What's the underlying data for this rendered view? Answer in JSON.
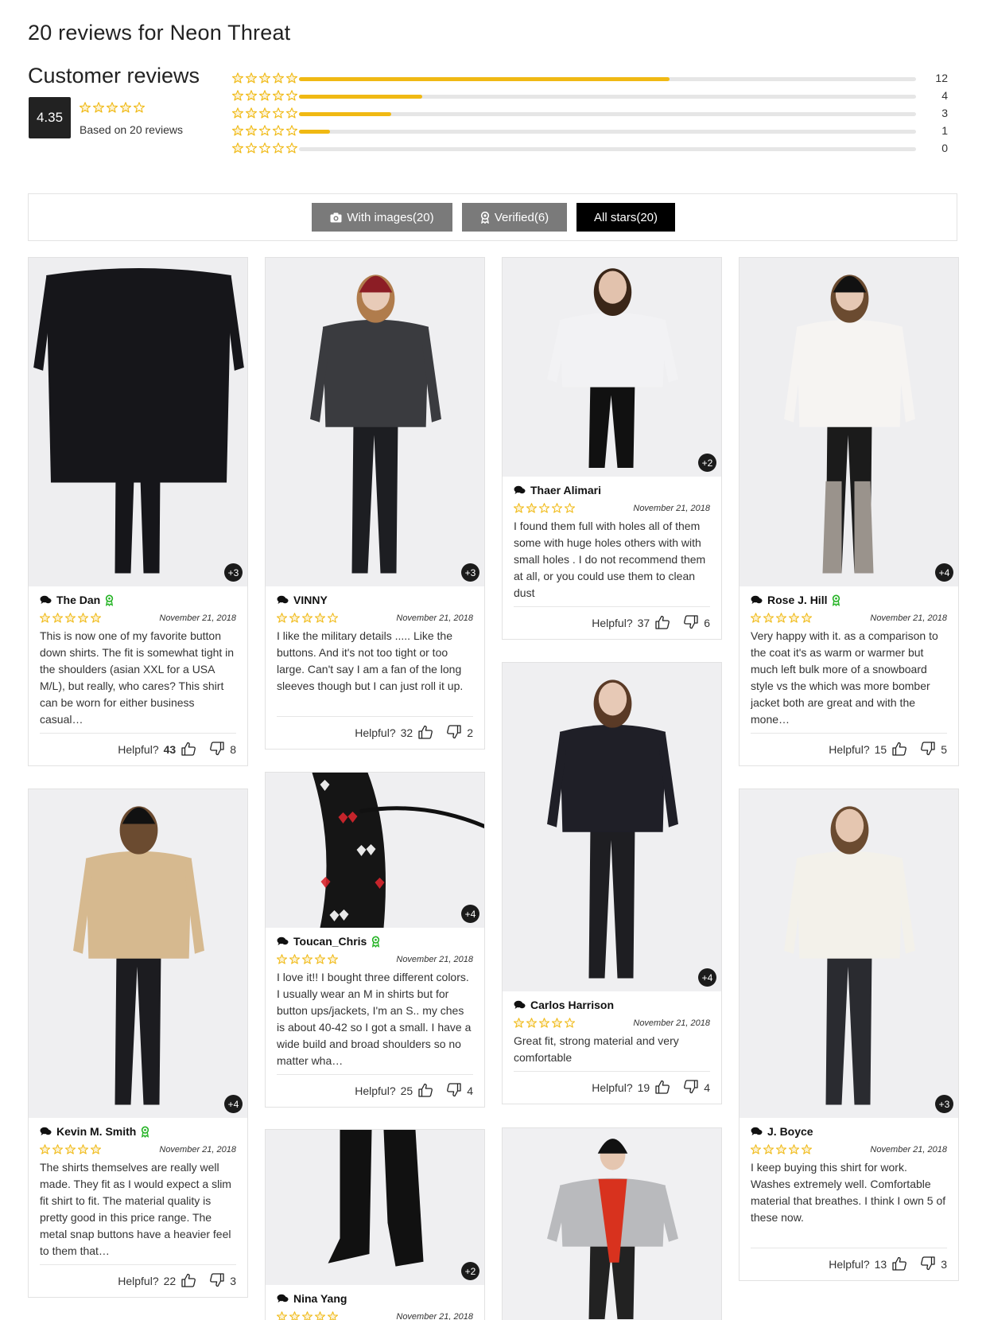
{
  "page_title": "20 reviews for Neon Threat",
  "summary": {
    "title": "Customer reviews",
    "average": "4.35",
    "based_on": "Based on 20 reviews",
    "distribution": [
      {
        "stars": 5,
        "count": "12",
        "fraction": 0.6
      },
      {
        "stars": 4,
        "count": "4",
        "fraction": 0.2
      },
      {
        "stars": 3,
        "count": "3",
        "fraction": 0.15
      },
      {
        "stars": 2,
        "count": "1",
        "fraction": 0.05
      },
      {
        "stars": 1,
        "count": "0",
        "fraction": 0
      }
    ]
  },
  "filters": {
    "with_images": "With images(20)",
    "verified": "Verified(6)",
    "all_stars": "All stars(20)"
  },
  "helpful_label": "Helpful?",
  "colors": {
    "star": "#f0b913",
    "verified": "#27b427",
    "accent_dark": "#000000"
  },
  "reviews": [
    {
      "author": "The Dan",
      "verified": true,
      "rating": 5,
      "date": "November 21, 2018",
      "more_images": "+3",
      "text": "This is now one of my favorite button down shirts. The fit is somewhat tight in the shoulders (asian XXL for a USA M/L), but really, who cares? This shirt can be worn for either business casual…",
      "helpful_yes": "43",
      "helpful_no": "8",
      "yes_bold": true
    },
    {
      "author": "VINNY",
      "verified": false,
      "rating": 4,
      "date": "November 21, 2018",
      "more_images": "+3",
      "text": "I like the military details ..... Like the buttons. And it's not too tight or too large. Can't say I am a fan of the long sleeves though but I can just roll it up.",
      "helpful_yes": "32",
      "helpful_no": "2"
    },
    {
      "author": "Thaer Alimari",
      "verified": false,
      "rating": 2,
      "date": "November 21, 2018",
      "more_images": "+2",
      "text": "I found them full with holes all of them some with huge holes others with with small holes . I do not recommend them at all, or you could use them to clean dust",
      "helpful_yes": "37",
      "helpful_no": "6"
    },
    {
      "author": "Rose J. Hill",
      "verified": true,
      "rating": 5,
      "date": "November 21, 2018",
      "more_images": "+4",
      "text": "Very happy with it. as a comparison to the coat it's as warm or warmer but much left bulk more of a snowboard style vs the which was more bomber jacket both are great and with the mone…",
      "helpful_yes": "15",
      "helpful_no": "5"
    },
    {
      "author": "Kevin M. Smith",
      "verified": true,
      "rating": 5,
      "date": "November 21, 2018",
      "more_images": "+4",
      "text": "The shirts themselves are really well made. They fit as I would expect a slim fit shirt to fit. The material quality is pretty good in this price range. The metal snap buttons have a heavier feel to them that…",
      "helpful_yes": "22",
      "helpful_no": "3"
    },
    {
      "author": "Toucan_Chris",
      "verified": true,
      "rating": 5,
      "date": "November 21, 2018",
      "more_images": "+4",
      "text": "I love it!! I bought three different colors. I usually wear an M in shirts but for button ups/jackets, I'm an S.. my ches is about 40-42 so I got a small. I have a wide build and broad shoulders so no matter wha…",
      "helpful_yes": "25",
      "helpful_no": "4"
    },
    {
      "author": "Carlos Harrison",
      "verified": false,
      "rating": 4,
      "date": "November 21, 2018",
      "more_images": "+4",
      "text": "Great fit, strong material and very comfortable",
      "helpful_yes": "19",
      "helpful_no": "4"
    },
    {
      "author": "J. Boyce",
      "verified": false,
      "rating": 5,
      "date": "November 21, 2018",
      "more_images": "+3",
      "text": "I keep buying this shirt for work. Washes extremely well. Comfortable material that breathes. I think I own 5 of these now.",
      "helpful_yes": "13",
      "helpful_no": "3"
    },
    {
      "author": "Nina Yang",
      "verified": false,
      "rating": 5,
      "date": "November 21, 2018",
      "more_images": "+2",
      "text": "",
      "helpful_yes": "",
      "helpful_no": ""
    }
  ]
}
